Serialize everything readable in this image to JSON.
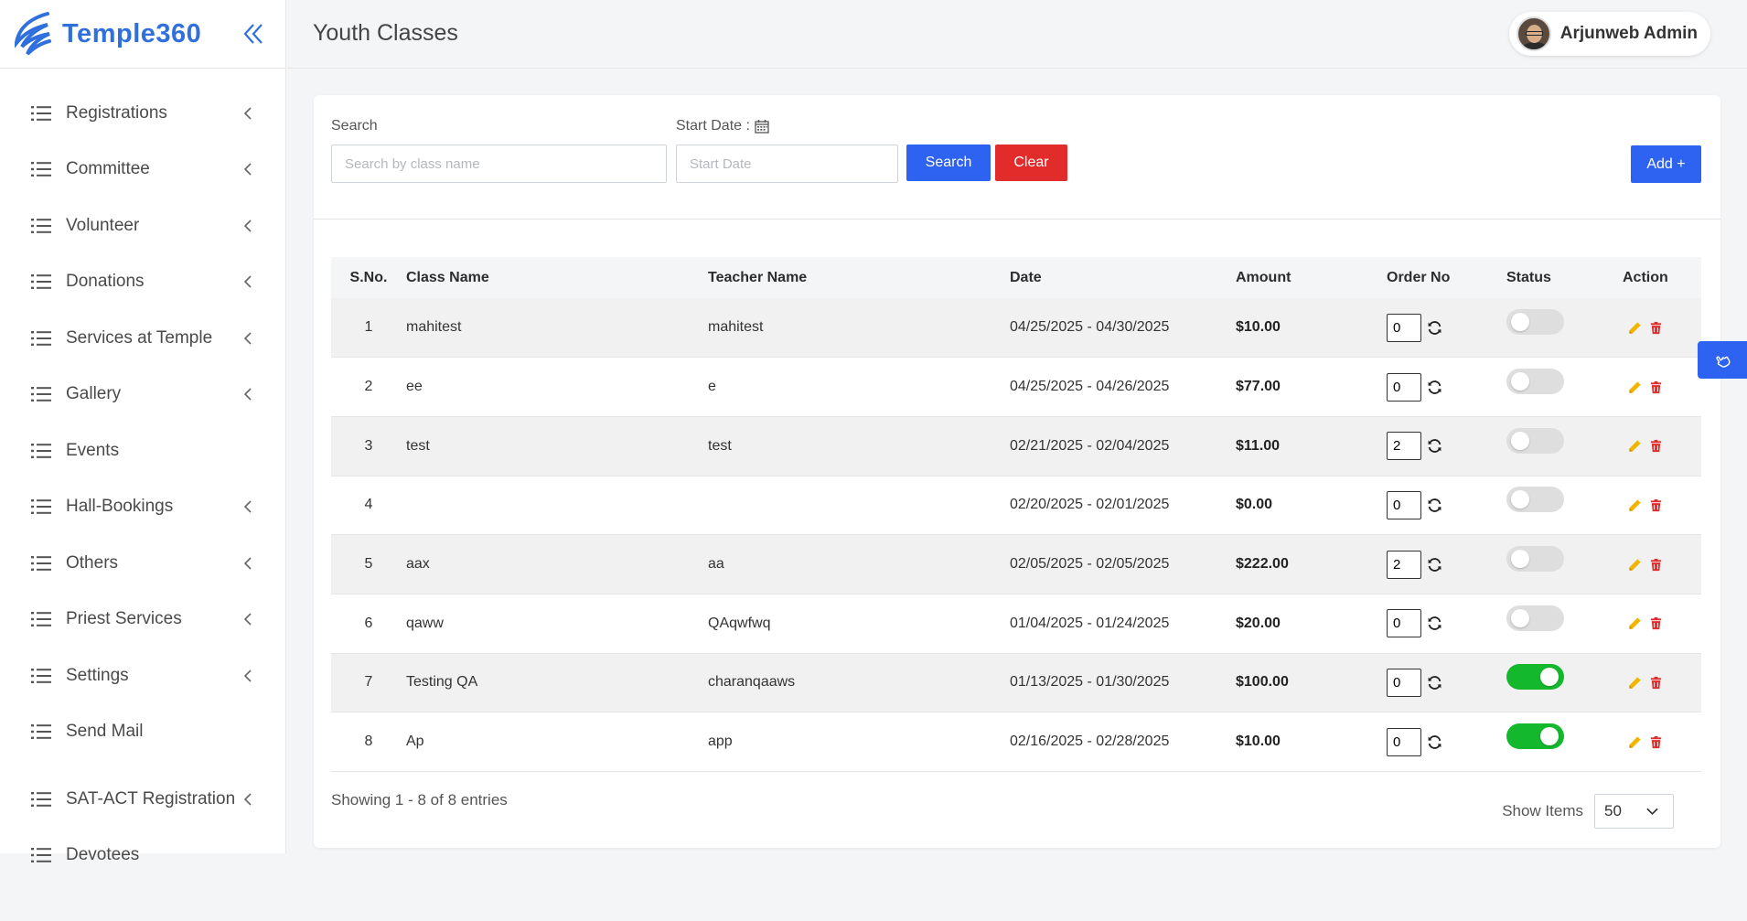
{
  "brand": {
    "name": "Temple360"
  },
  "header": {
    "title": "Youth Classes",
    "user_name": "Arjunweb Admin"
  },
  "sidebar": {
    "items": [
      {
        "label": "Registrations",
        "has_submenu": true
      },
      {
        "label": "Committee",
        "has_submenu": true
      },
      {
        "label": "Volunteer",
        "has_submenu": true
      },
      {
        "label": "Donations",
        "has_submenu": true
      },
      {
        "label": "Services at Temple",
        "has_submenu": true
      },
      {
        "label": "Gallery",
        "has_submenu": true
      },
      {
        "label": "Events",
        "has_submenu": false
      },
      {
        "label": "Hall-Bookings",
        "has_submenu": true
      },
      {
        "label": "Others",
        "has_submenu": true
      },
      {
        "label": "Priest Services",
        "has_submenu": true
      },
      {
        "label": "Settings",
        "has_submenu": true
      },
      {
        "label": "Send Mail",
        "has_submenu": false
      },
      {
        "label": "SAT-ACT Registration",
        "has_submenu": true
      },
      {
        "label": "Devotees",
        "has_submenu": false
      }
    ]
  },
  "filters": {
    "search_label": "Search",
    "search_placeholder": "Search by class name",
    "search_value": "",
    "start_date_label": "Start Date :",
    "start_date_placeholder": "Start Date",
    "start_date_value": "",
    "search_button": "Search",
    "clear_button": "Clear",
    "add_button": "Add +"
  },
  "table": {
    "columns": [
      "S.No.",
      "Class Name",
      "Teacher Name",
      "Date",
      "Amount",
      "Order No",
      "Status",
      "Action"
    ],
    "rows": [
      {
        "sno": "1",
        "class_name": "mahitest",
        "teacher": "mahitest",
        "date": "04/25/2025 - 04/30/2025",
        "amount": "$10.00",
        "order": "0",
        "status_on": false
      },
      {
        "sno": "2",
        "class_name": "ee",
        "teacher": "e",
        "date": "04/25/2025 - 04/26/2025",
        "amount": "$77.00",
        "order": "0",
        "status_on": false
      },
      {
        "sno": "3",
        "class_name": "test",
        "teacher": "test",
        "date": "02/21/2025 - 02/04/2025",
        "amount": "$11.00",
        "order": "2",
        "status_on": false
      },
      {
        "sno": "4",
        "class_name": "",
        "teacher": "",
        "date": "02/20/2025 - 02/01/2025",
        "amount": "$0.00",
        "order": "0",
        "status_on": false
      },
      {
        "sno": "5",
        "class_name": "aax",
        "teacher": "aa",
        "date": "02/05/2025 - 02/05/2025",
        "amount": "$222.00",
        "order": "2",
        "status_on": false
      },
      {
        "sno": "6",
        "class_name": "qaww",
        "teacher": "QAqwfwq",
        "date": "01/04/2025 - 01/24/2025",
        "amount": "$20.00",
        "order": "0",
        "status_on": false
      },
      {
        "sno": "7",
        "class_name": "Testing QA",
        "teacher": "charanqaaws",
        "date": "01/13/2025 - 01/30/2025",
        "amount": "$100.00",
        "order": "0",
        "status_on": true
      },
      {
        "sno": "8",
        "class_name": "Ap",
        "teacher": "app",
        "date": "02/16/2025 - 02/28/2025",
        "amount": "$10.00",
        "order": "0",
        "status_on": true
      }
    ]
  },
  "footer": {
    "entries_text": "Showing 1 - 8 of 8 entries",
    "show_items_label": "Show Items",
    "show_items_value": "50"
  },
  "icons": {
    "collapse": "double-chevron-left-icon",
    "menu_item": "list-icon",
    "submenu": "chevron-left-icon",
    "calendar": "calendar-icon",
    "refresh": "refresh-icon",
    "edit": "pencil-icon",
    "delete": "trash-icon",
    "float": "hand-pointer-icon"
  },
  "colors": {
    "brand": "#2f6fde",
    "primary": "#2d63f0",
    "danger": "#e22b2b",
    "toggle_on": "#14b82c",
    "toggle_off": "#dedede",
    "edit_icon": "#f1b500",
    "delete_icon": "#e22b2b"
  }
}
